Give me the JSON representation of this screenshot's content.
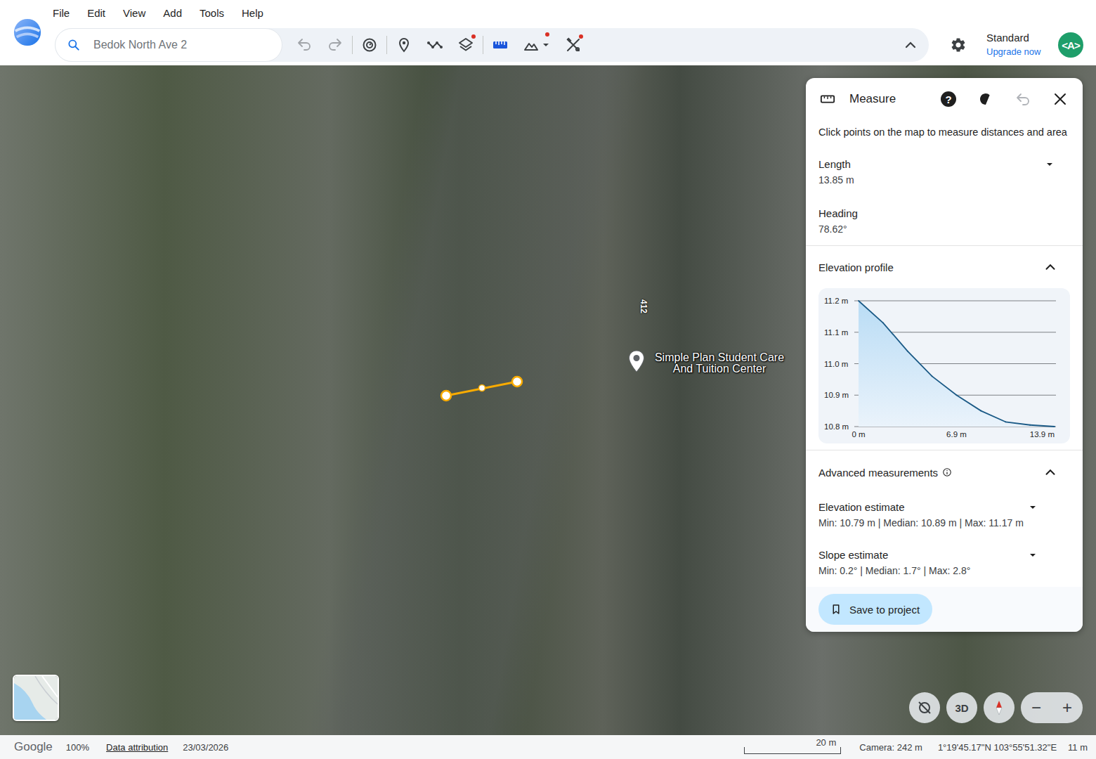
{
  "app": {
    "menu": [
      "File",
      "Edit",
      "View",
      "Add",
      "Tools",
      "Help"
    ]
  },
  "search": {
    "value": "Bedok North Ave 2"
  },
  "toolbar": {
    "undo_disabled": true,
    "redo_disabled": true,
    "layers_badge": true,
    "terrain_badge": true,
    "tools_badge": true,
    "measure_active": true
  },
  "account": {
    "plan": "Standard",
    "upgrade": "Upgrade now",
    "avatar": "<A>"
  },
  "map": {
    "place_label": "Simple Plan Student Care And Tuition Center",
    "building_label": "412"
  },
  "panel": {
    "title": "Measure",
    "help": "?",
    "undo_disabled": true,
    "hint": "Click points on the map to measure distances and area",
    "length": {
      "label": "Length",
      "value": "13.85 m"
    },
    "heading": {
      "label": "Heading",
      "value": "78.62°"
    },
    "elevation_profile": {
      "title": "Elevation profile",
      "expanded": true,
      "chart": {
        "y_ticks": [
          "11.2 m",
          "11.1 m",
          "11.0 m",
          "10.9 m",
          "10.8 m"
        ],
        "x_ticks": [
          "0 m",
          "6.9 m",
          "13.9 m"
        ],
        "series": [
          {
            "values": [
              11.2,
              11.13,
              11.04,
              10.96,
              10.9,
              10.85,
              10.815,
              10.805,
              10.8
            ]
          }
        ]
      }
    },
    "advanced": {
      "title": "Advanced measurements",
      "expanded": true,
      "items": [
        {
          "label": "Elevation estimate",
          "value": "Min: 10.79 m | Median: 10.89 m | Max: 11.17 m"
        },
        {
          "label": "Slope estimate",
          "value": "Min: 0.2° | Median: 1.7° | Max: 2.8°"
        }
      ]
    },
    "save": "Save to project"
  },
  "controls": {
    "view_3d": "3D",
    "zoom_out": "−",
    "zoom_in": "+"
  },
  "status_bar": {
    "brand": "Google",
    "zoom": "100%",
    "attribution": "Data attribution",
    "date": "23/03/2026",
    "scale": "20 m",
    "camera": "Camera: 242 m",
    "coordinates": "1°19'45.17\"N 103°55'51.32\"E",
    "altitude": "11 m"
  }
}
